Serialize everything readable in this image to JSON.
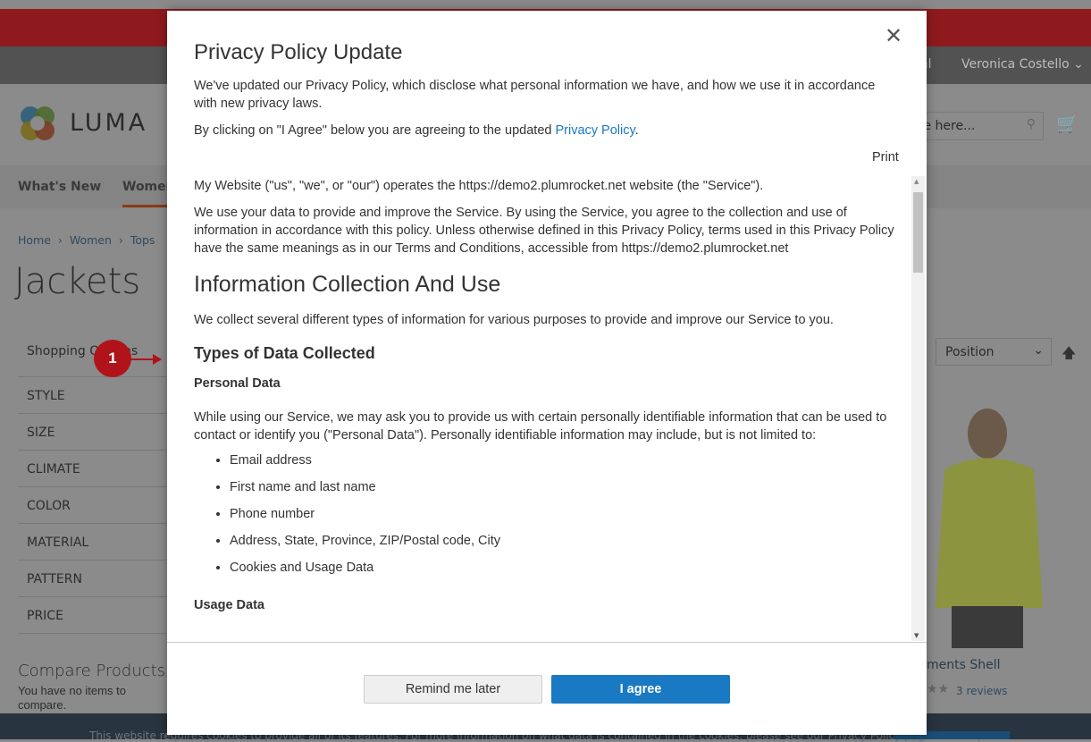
{
  "background": {
    "header_link_partial": "al",
    "customer_name": "Veronica Costello",
    "logo_text": "LUMA",
    "search_placeholder": "Search entire store here...",
    "search_visible": "re here...",
    "nav": [
      "What's New",
      "Women"
    ],
    "breadcrumb": [
      "Home",
      "Women",
      "Tops"
    ],
    "page_title": "Jackets",
    "shopping_options": "Shopping Options",
    "filters": [
      "STYLE",
      "SIZE",
      "CLIMATE",
      "COLOR",
      "MATERIAL",
      "PATTERN",
      "PRICE"
    ],
    "compare_title": "Compare Products",
    "compare_text": "You have no items to compare.",
    "sort_select": "Position",
    "product_name_partial": "ments Shell",
    "reviews": "3 reviews",
    "cookie_text": "This website requires cookies to provide all of its features. For more information on what data is contained in the cookies, please see our Privacy Policy page. To accept"
  },
  "annotation": {
    "number": "1",
    "color": "#c0171c"
  },
  "modal": {
    "title": "Privacy Policy Update",
    "intro": "We've updated our Privacy Policy, which disclose what personal information we have, and how we use it in accordance with new privacy laws.",
    "agree_prefix": "By clicking on \"I Agree\" below you are agreeing to the updated ",
    "agree_link": "Privacy Policy",
    "agree_suffix": ".",
    "print": "Print",
    "content": {
      "p1": "My Website (\"us\", \"we\", or \"our\") operates the https://demo2.plumrocket.net website (the \"Service\").",
      "p2": "We use your data to provide and improve the Service. By using the Service, you agree to the collection and use of information in accordance with this policy. Unless otherwise defined in this Privacy Policy, terms used in this Privacy Policy have the same meanings as in our Terms and Conditions, accessible from https://demo2.plumrocket.net",
      "h2": "Information Collection And Use",
      "p3": "We collect several different types of information for various purposes to provide and improve our Service to you.",
      "h3": "Types of Data Collected",
      "h4a": "Personal Data",
      "p4": "While using our Service, we may ask you to provide us with certain personally identifiable information that can be used to contact or identify you (\"Personal Data\"). Personally identifiable information may include, but is not limited to:",
      "list": [
        "Email address",
        "First name and last name",
        "Phone number",
        "Address, State, Province, ZIP/Postal code, City",
        "Cookies and Usage Data"
      ],
      "h4b": "Usage Data"
    },
    "remind_label": "Remind me later",
    "agree_label": "I agree",
    "accent": "#1979c3"
  }
}
